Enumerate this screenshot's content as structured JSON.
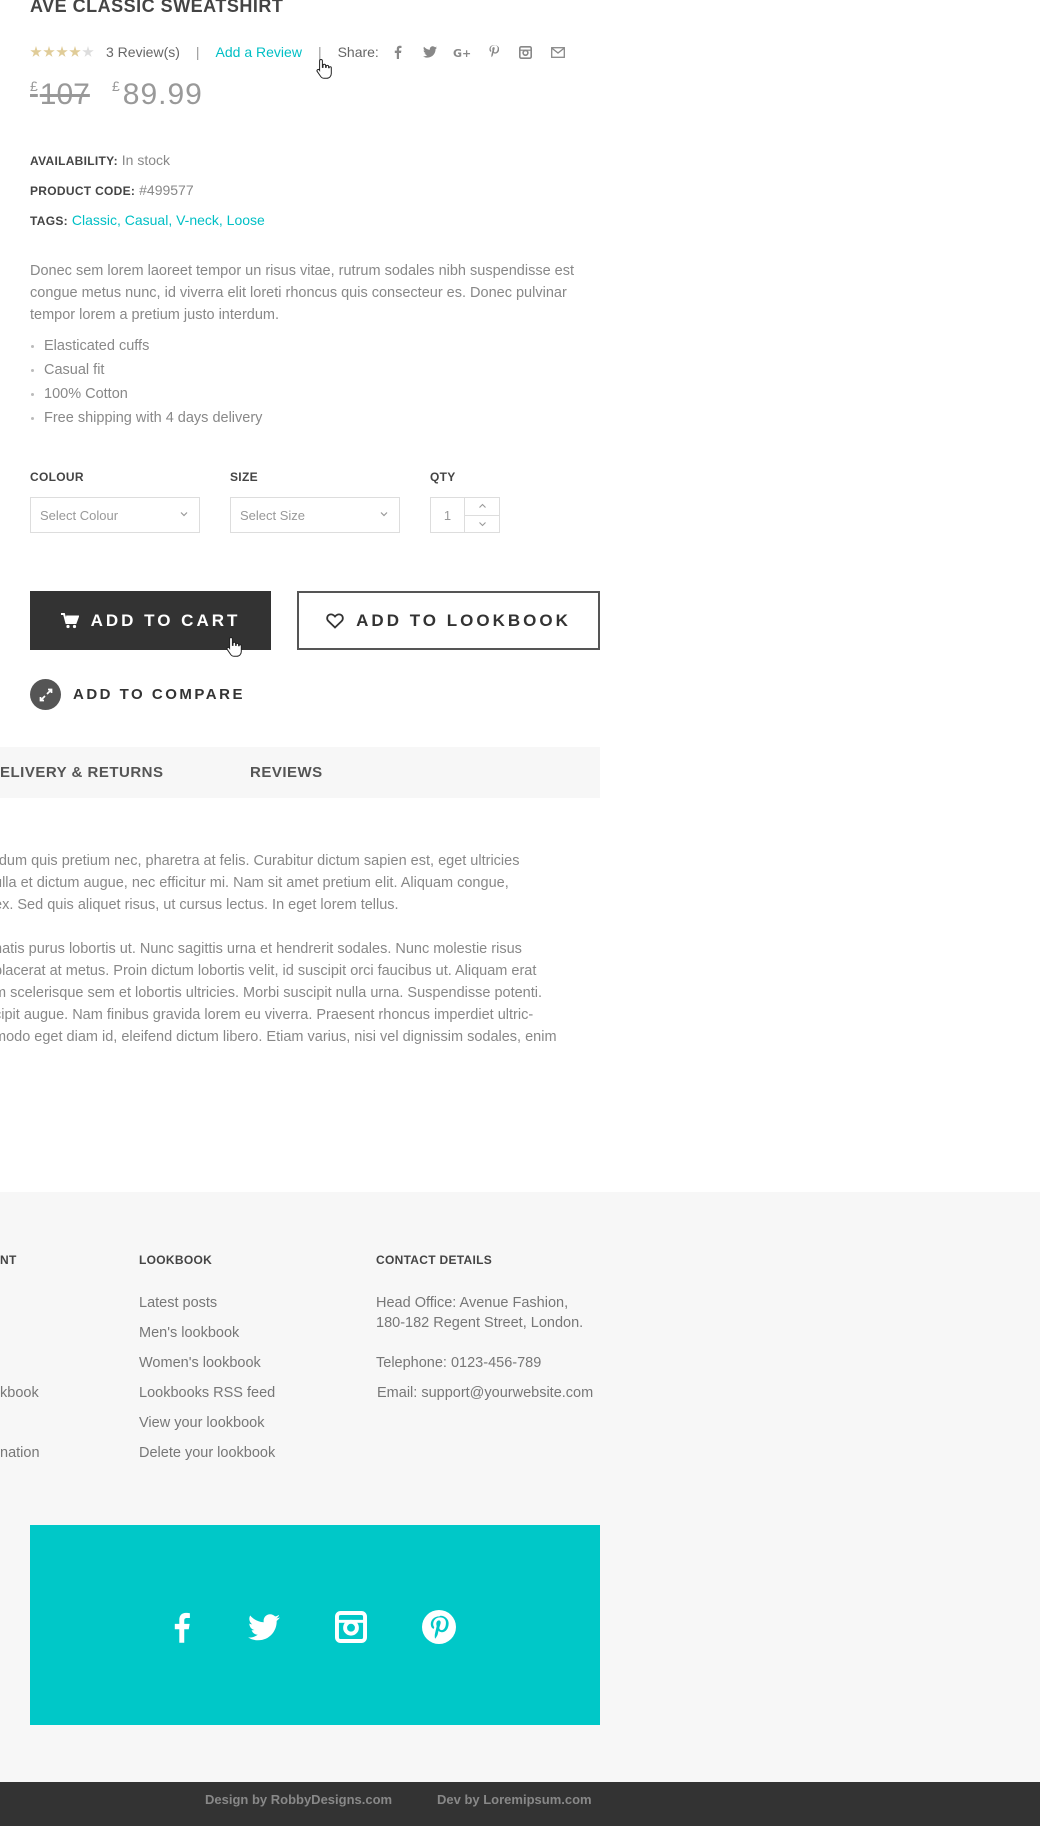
{
  "product": {
    "title": "AVE CLASSIC SWEATSHIRT",
    "rating": 4,
    "rating_max": 5,
    "reviews_count_label": "3 Review(s)",
    "add_review_label": "Add a Review",
    "share_label": "Share:",
    "share_icons": [
      "facebook-icon",
      "twitter-icon",
      "google-plus-icon",
      "pinterest-icon",
      "instagram-icon",
      "email-icon"
    ],
    "currency_symbol": "£",
    "old_price": "107",
    "new_price": "89.99",
    "availability_key": "AVAILABILITY:",
    "availability_value": "In stock",
    "code_key": "PRODUCT CODE:",
    "code_value": "#499577",
    "tags_key": "TAGS:",
    "tags_value": "Classic, Casual, V-neck, Loose",
    "description": "Donec sem lorem laoreet tempor un risus vitae, rutrum sodales nibh suspendisse est congue metus nunc, id viverra elit loreti rhoncus quis consecteur es. Donec pulvinar tempor lorem a pretium justo interdum.",
    "features": [
      "Elasticated cuffs",
      "Casual fit",
      "100% Cotton",
      "Free shipping with 4 days delivery"
    ]
  },
  "options": {
    "colour_label": "COLOUR",
    "colour_placeholder": "Select Colour",
    "size_label": "SIZE",
    "size_placeholder": "Select Size",
    "qty_label": "QTY",
    "qty_value": "1"
  },
  "actions": {
    "add_to_cart": "ADD TO CART",
    "add_to_lookbook": "ADD TO LOOKBOOK",
    "add_to_compare": "ADD TO COMPARE"
  },
  "tabs": {
    "delivery": "ELIVERY & RETURNS",
    "reviews": "REVIEWS"
  },
  "tab_content": {
    "para1_lines": [
      "rdum quis pretium nec, pharetra at felis. Curabitur dictum sapien est, eget ultricies",
      "ulla et dictum augue, nec efficitur mi. Nam sit amet pretium elit. Aliquam congue,",
      "ex. Sed quis aliquet risus, ut cursus lectus. In eget lorem tellus."
    ],
    "para2_lines": [
      "natis purus lobortis ut. Nunc sagittis urna et hendrerit sodales. Nunc molestie risus",
      "placerat at metus. Proin dictum lobortis velit, id suscipit orci faucibus ut. Aliquam erat",
      "m scelerisque sem et lobortis ultricies. Morbi suscipit nulla urna. Suspendisse potenti.",
      "cipit augue. Nam finibus gravida lorem eu viverra. Praesent rhoncus imperdiet ultric-",
      "modo eget diam id, eleifend dictum libero. Etiam varius, nisi vel dignissim sodales, enim"
    ]
  },
  "footer": {
    "col1_heading": "NT",
    "col1_links": [
      "kbook",
      "",
      "nation"
    ],
    "lookbook_heading": "LOOKBOOK",
    "lookbook_links": [
      "Latest posts",
      "Men's lookbook",
      "Women's lookbook",
      "Lookbooks RSS feed",
      "View your lookbook",
      "Delete your lookbook"
    ],
    "contact_heading": "CONTACT DETAILS",
    "address_line1": "Head Office: Avenue Fashion,",
    "address_line2": "180-182 Regent Street, London.",
    "telephone": "Telephone: 0123-456-789",
    "email": "Email: support@yourwebsite.com",
    "social_icons": [
      "facebook-icon",
      "twitter-icon",
      "instagram-icon",
      "pinterest-icon"
    ],
    "social_bg_color": "#00c8c8",
    "credit_design": "Design by RobbyDesigns.com",
    "credit_dev": "Dev by Loremipsum.com"
  }
}
